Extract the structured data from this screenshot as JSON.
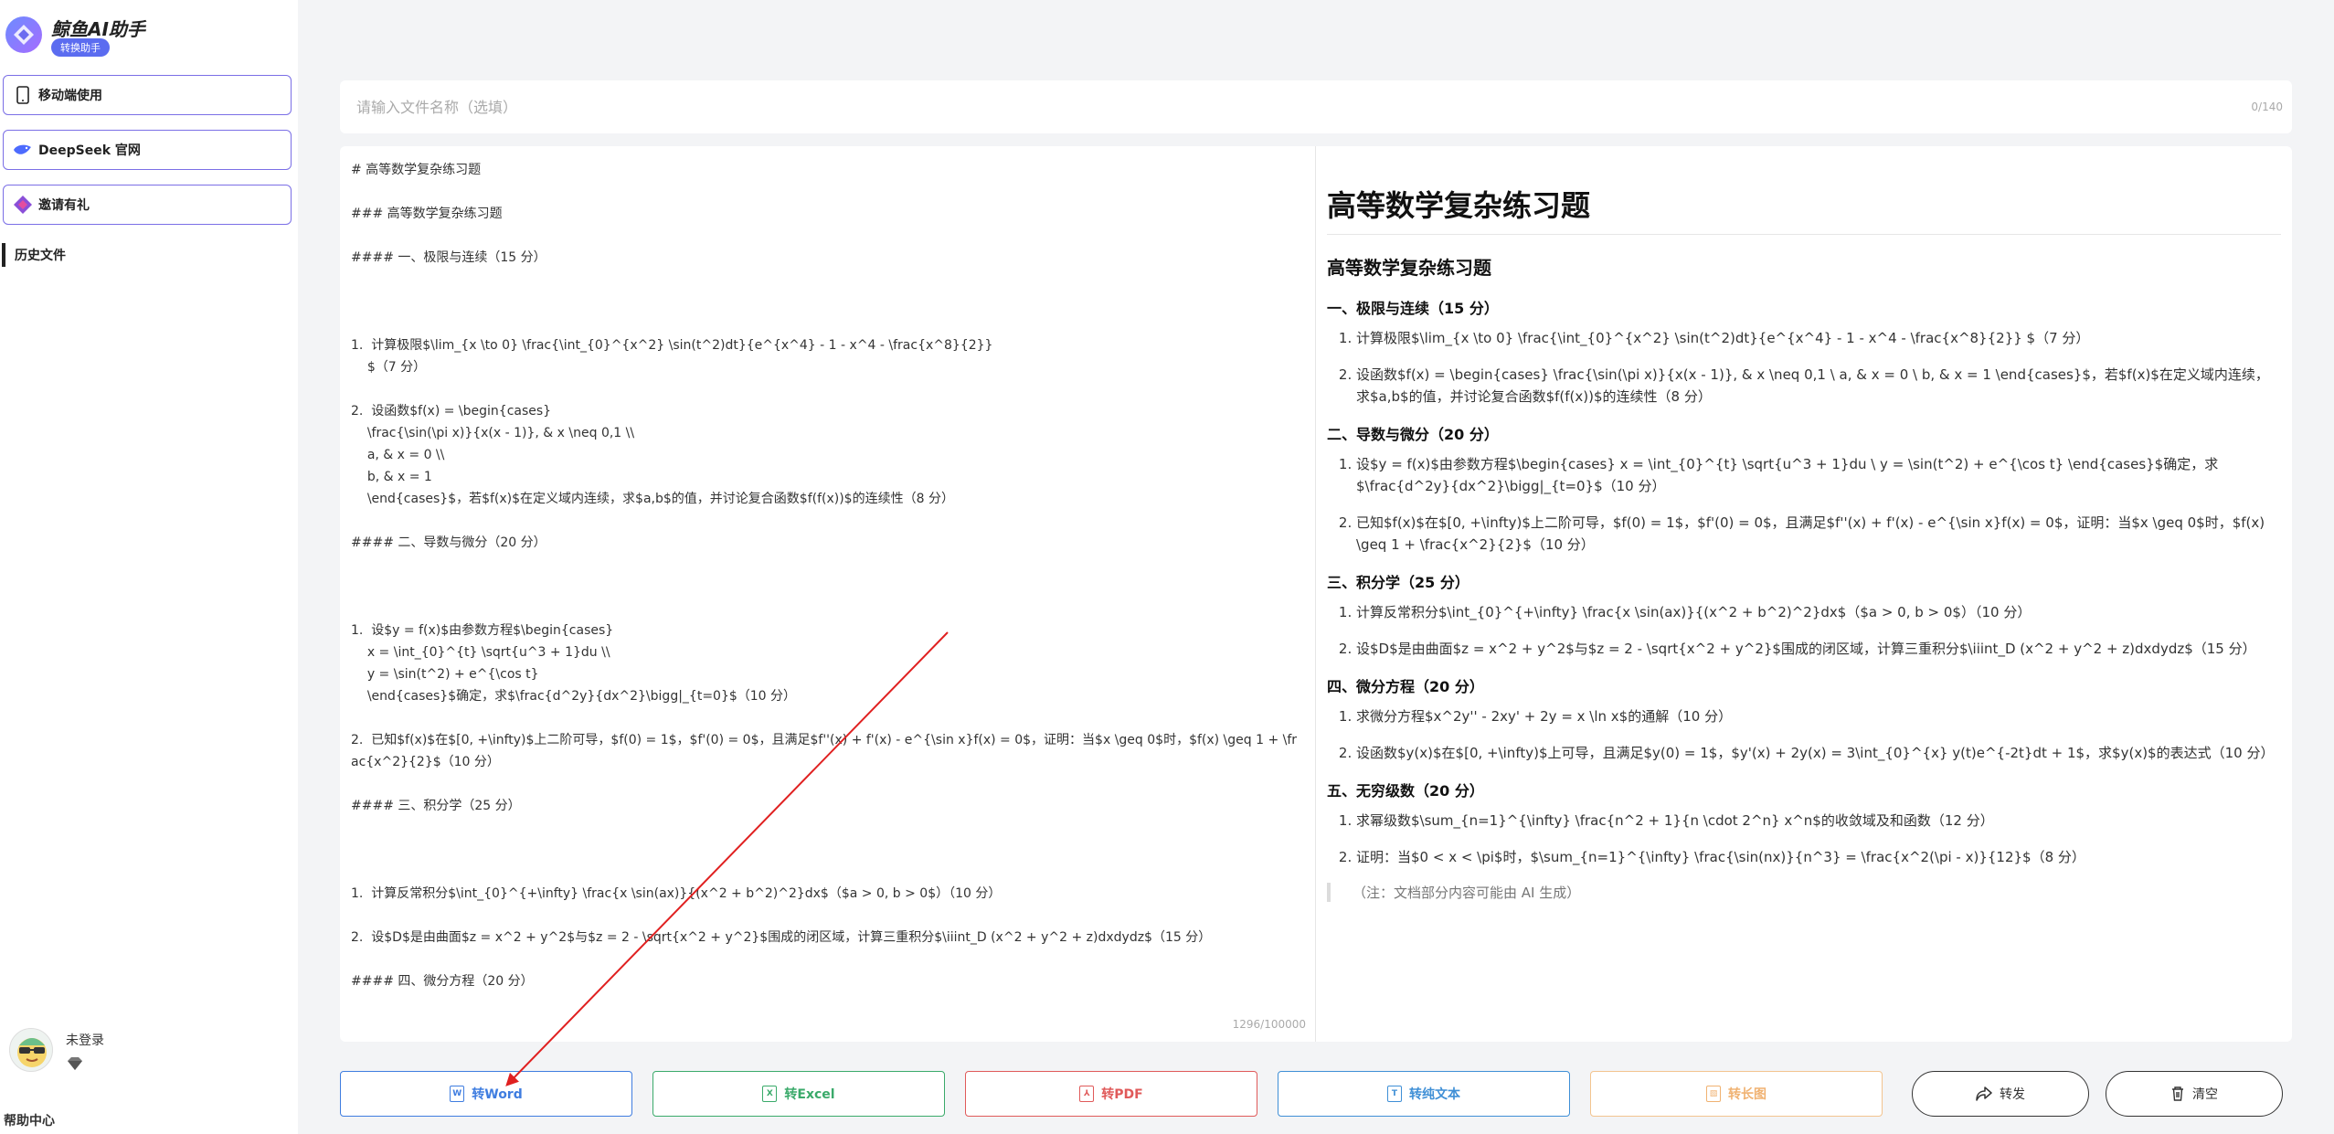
{
  "sidebar": {
    "app_title": "鲸鱼AI助手",
    "app_badge": "转换助手",
    "buttons": [
      {
        "label": "移动端使用",
        "icon": "phone-icon"
      },
      {
        "label": "DeepSeek 官网",
        "icon": "deepseek-whale-icon"
      },
      {
        "label": "邀请有礼",
        "icon": "gift-icon"
      }
    ],
    "history_label": "历史文件",
    "user_name": "未登录",
    "help_label": "帮助中心"
  },
  "title_input": {
    "placeholder": "请输入文件名称（选填）",
    "value": "",
    "counter": "0/140"
  },
  "editor": {
    "content": "# 高等数学复杂练习题\n\n### 高等数学复杂练习题\n\n#### 一、极限与连续（15 分）\n\n\n\n1.  计算极限$\\lim_{x \\to 0} \\frac{\\int_{0}^{x^2} \\sin(t^2)dt}{e^{x^4} - 1 - x^4 - \\frac{x^8}{2}}\n    $（7 分）\n\n2.  设函数$f(x) = \\begin{cases}\n    \\frac{\\sin(\\pi x)}{x(x - 1)}, & x \\neq 0,1 \\\\\n    a, & x = 0 \\\\\n    b, & x = 1\n    \\end{cases}$，若$f(x)$在定义域内连续，求$a,b$的值，并讨论复合函数$f(f(x))$的连续性（8 分）\n\n#### 二、导数与微分（20 分）\n\n\n\n1.  设$y = f(x)$由参数方程$\\begin{cases}\n    x = \\int_{0}^{t} \\sqrt{u^3 + 1}du \\\\\n    y = \\sin(t^2) + e^{\\cos t}\n    \\end{cases}$确定，求$\\frac{d^2y}{dx^2}\\bigg|_{t=0}$（10 分）\n\n2.  已知$f(x)$在$[0, +\\infty)$上二阶可导，$f(0) = 1$，$f'(0) = 0$，且满足$f''(x) + f'(x) - e^{\\sin x}f(x) = 0$，证明：当$x \\geq 0$时，$f(x) \\geq 1 + \\frac{x^2}{2}$（10 分）\n\n#### 三、积分学（25 分）\n\n\n\n1.  计算反常积分$\\int_{0}^{+\\infty} \\frac{x \\sin(ax)}{(x^2 + b^2)^2}dx$（$a > 0, b > 0$）（10 分）\n\n2.  设$D$是由曲面$z = x^2 + y^2$与$z = 2 - \\sqrt{x^2 + y^2}$围成的闭区域，计算三重积分$\\iiint_D (x^2 + y^2 + z)dxdydz$（15 分）\n\n#### 四、微分方程（20 分）",
    "counter": "1296/100000"
  },
  "preview": {
    "h1": "高等数学复杂练习题",
    "h3": "高等数学复杂练习题",
    "sections": [
      {
        "heading": "一、极限与连续（15 分）",
        "items": [
          "计算极限$\\lim_{x \\to 0} \\frac{\\int_{0}^{x^2} \\sin(t^2)dt}{e^{x^4} - 1 - x^4 - \\frac{x^8}{2}} $（7 分）",
          "设函数$f(x) = \\begin{cases} \\frac{\\sin(\\pi x)}{x(x - 1)}, & x \\neq 0,1 \\ a, & x = 0 \\ b, & x = 1 \\end{cases}$，若$f(x)$在定义域内连续，求$a,b$的值，并讨论复合函数$f(f(x))$的连续性（8 分）"
        ]
      },
      {
        "heading": "二、导数与微分（20 分）",
        "items": [
          "设$y = f(x)$由参数方程$\\begin{cases} x = \\int_{0}^{t} \\sqrt{u^3 + 1}du \\ y = \\sin(t^2) + e^{\\cos t} \\end{cases}$确定，求$\\frac{d^2y}{dx^2}\\bigg|_{t=0}$（10 分）",
          "已知$f(x)$在$[0, +\\infty)$上二阶可导，$f(0) = 1$，$f'(0) = 0$，且满足$f''(x) + f'(x) - e^{\\sin x}f(x) = 0$，证明：当$x \\geq 0$时，$f(x) \\geq 1 + \\frac{x^2}{2}$（10 分）"
        ]
      },
      {
        "heading": "三、积分学（25 分）",
        "items": [
          "计算反常积分$\\int_{0}^{+\\infty} \\frac{x \\sin(ax)}{(x^2 + b^2)^2}dx$（$a > 0, b > 0$）（10 分）",
          "设$D$是由曲面$z = x^2 + y^2$与$z = 2 - \\sqrt{x^2 + y^2}$围成的闭区域，计算三重积分$\\iiint_D (x^2 + y^2 + z)dxdydz$（15 分）"
        ]
      },
      {
        "heading": "四、微分方程（20 分）",
        "items": [
          "求微分方程$x^2y'' - 2xy' + 2y = x \\ln x$的通解（10 分）",
          "设函数$y(x)$在$[0, +\\infty)$上可导，且满足$y(0) = 1$，$y'(x) + 2y(x) = 3\\int_{0}^{x} y(t)e^{-2t}dt + 1$，求$y(x)$的表达式（10 分）"
        ]
      },
      {
        "heading": "五、无穷级数（20 分）",
        "items": [
          "求幂级数$\\sum_{n=1}^{\\infty} \\frac{n^2 + 1}{n \\cdot 2^n} x^n$的收敛域及和函数（12 分）",
          "证明：当$0 < x < \\pi$时，$\\sum_{n=1}^{\\infty} \\frac{\\sin(nx)}{n^3} = \\frac{x^2(\\pi - x)}{12}$（8 分）"
        ]
      }
    ],
    "note": "（注：文档部分内容可能由 AI 生成）"
  },
  "actions": {
    "to_word": "转Word",
    "to_excel": "转Excel",
    "to_pdf": "转PDF",
    "to_text": "转纯文本",
    "to_image": "转长图",
    "share": "转发",
    "clear": "清空",
    "icon_word": "W",
    "icon_excel": "X",
    "icon_pdf": "⅄",
    "icon_text": "T",
    "icon_image": "▧"
  },
  "colors": {
    "word": "#3f7de0",
    "excel": "#3aaa6a",
    "pdf": "#e05a5a",
    "text": "#3f8fd6",
    "image": "#f3b26b",
    "annotation_arrow": "#e02020"
  }
}
